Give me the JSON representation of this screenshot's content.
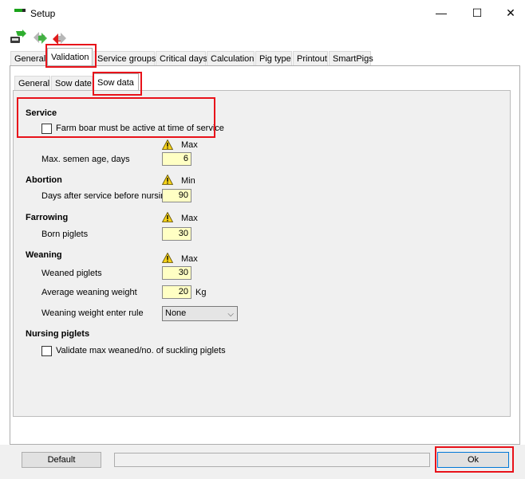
{
  "window": {
    "title": "Setup",
    "minimize_glyph": "—",
    "maximize_glyph": "☐",
    "close_glyph": "✕"
  },
  "toolbar": {
    "icons": [
      "save-icon",
      "undo-icon",
      "cancel-icon"
    ]
  },
  "main_tabs": [
    "General",
    "Validation",
    "Service groups",
    "Critical days",
    "Calculation",
    "Pig type",
    "Printout",
    "SmartPigs"
  ],
  "sub_tabs": [
    "General",
    "Sow date",
    "Sow data"
  ],
  "service": {
    "heading": "Service",
    "checkbox_label": "Farm boar must be active at time of service",
    "limit_header": "Max",
    "semen_label": "Max. semen age, days",
    "semen_value": "6"
  },
  "abortion": {
    "heading": "Abortion",
    "limit_header": "Min",
    "days_label": "Days after service before nursing",
    "days_value": "90"
  },
  "farrowing": {
    "heading": "Farrowing",
    "limit_header": "Max",
    "born_label": "Born piglets",
    "born_value": "30"
  },
  "weaning": {
    "heading": "Weaning",
    "limit_header": "Max",
    "weaned_label": "Weaned piglets",
    "weaned_value": "30",
    "weight_label": "Average weaning weight",
    "weight_value": "20",
    "weight_unit": "Kg",
    "rule_label": "Weaning weight enter rule",
    "rule_value": "None"
  },
  "nursing": {
    "heading": "Nursing piglets",
    "checkbox_label": "Validate max weaned/no. of suckling piglets"
  },
  "footer": {
    "default_label": "Default",
    "ok_label": "Ok"
  },
  "colors": {
    "highlight": "#e8121a",
    "field_bg": "#ffffc4"
  }
}
